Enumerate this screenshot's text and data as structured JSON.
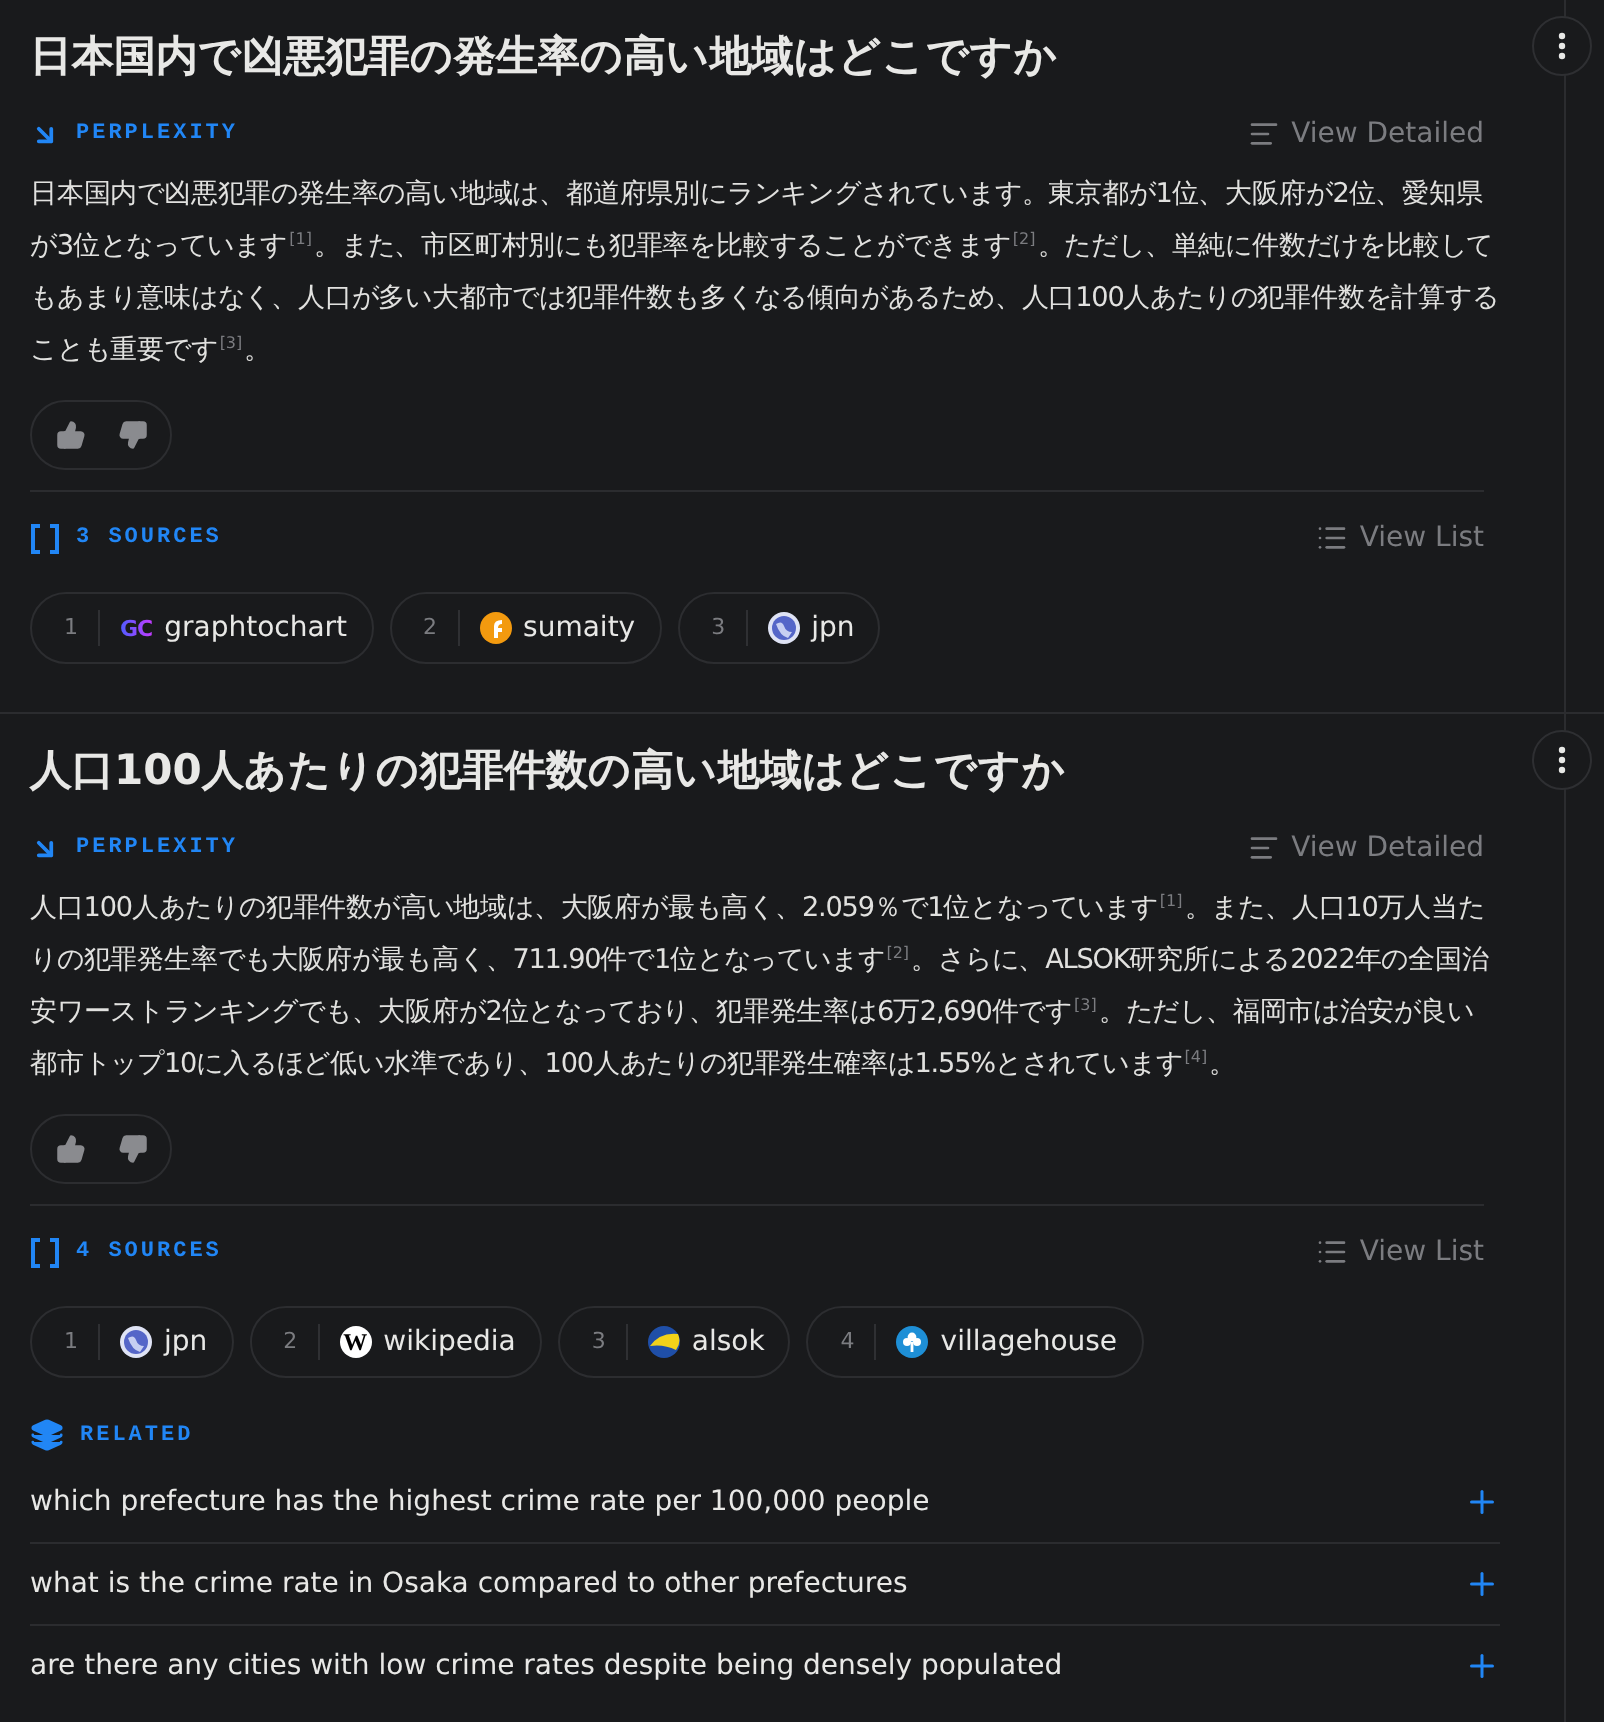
{
  "threads": [
    {
      "question": "日本国内で凶悪犯罪の発生率の高い地域はどこですか",
      "answer_label": "PERPLEXITY",
      "view_detailed": "View Detailed",
      "answer": "日本国内で凶悪犯罪の発生率の高い地域は、都道府県別にランキングされています。東京都が1位、大阪府が2位、愛知県が3位となっています$^{[1]}$。また、市区町村別にも犯罪率を比較することができます$^{[2]}$。ただし、単純に件数だけを比較してもあまり意味はなく、人口が多い大都市では犯罪件数も多くなる傾向があるため、人口100人あたりの犯罪件数を計算することも重要です$^{[3]}$。",
      "sources_label": "3 SOURCES",
      "view_list": "View List",
      "sources": [
        {
          "index": "1",
          "name": "graphtochart",
          "kind": "gc",
          "logo": "GC"
        },
        {
          "index": "2",
          "name": "sumaity",
          "kind": "sumaity"
        },
        {
          "index": "3",
          "name": "jpn",
          "kind": "globe"
        }
      ]
    },
    {
      "question": "人口100人あたりの犯罪件数の高い地域はどこですか",
      "answer_label": "PERPLEXITY",
      "view_detailed": "View Detailed",
      "answer": "人口100人あたりの犯罪件数が高い地域は、大阪府が最も高く、2.059％で1位となっています$^{[1]}$。また、人口10万人当たりの犯罪発生率でも大阪府が最も高く、711.90件で1位となっています$^{[2]}$。さらに、ALSOK研究所による2022年の全国治安ワーストランキングでも、大阪府が2位となっており、犯罪発生率は6万2,690件です$^{[3]}$。ただし、福岡市は治安が良い都市トップ10に入るほど低い水準であり、100人あたりの犯罪発生確率は1.55%とされています$^{[4]}$。",
      "sources_label": "4 SOURCES",
      "view_list": "View List",
      "sources": [
        {
          "index": "1",
          "name": "jpn",
          "kind": "globe"
        },
        {
          "index": "2",
          "name": "wikipedia",
          "kind": "wiki",
          "logo": "W"
        },
        {
          "index": "3",
          "name": "alsok",
          "kind": "alsok"
        },
        {
          "index": "4",
          "name": "villagehouse",
          "kind": "village"
        }
      ]
    }
  ],
  "related": {
    "label": "RELATED",
    "items": [
      {
        "text": "which prefecture has the highest crime rate per 100,000 people"
      },
      {
        "text": "what is the crime rate in Osaka compared to other prefectures"
      },
      {
        "text": "are there any cities with low crime rates despite being densely populated"
      }
    ]
  }
}
